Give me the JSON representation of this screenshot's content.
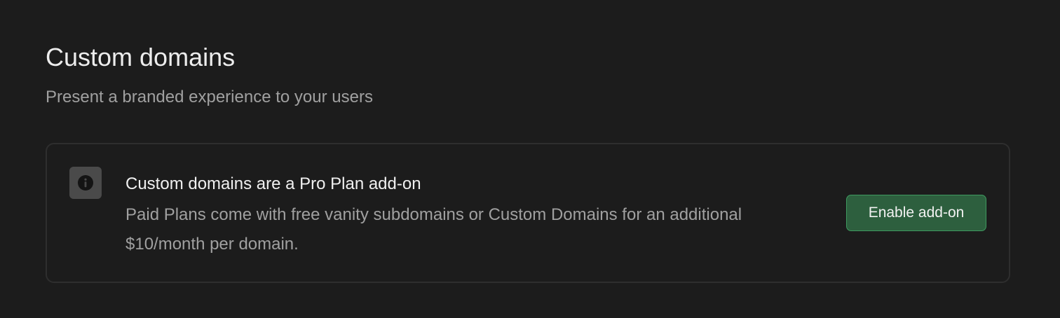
{
  "section": {
    "title": "Custom domains",
    "subtitle": "Present a branded experience to your users"
  },
  "notice": {
    "icon": "info-icon",
    "title": "Custom domains are a Pro Plan add-on",
    "description": "Paid Plans come with free vanity subdomains or Custom Domains for an additional $10/month per domain.",
    "button_label": "Enable add-on"
  },
  "colors": {
    "background": "#1c1c1c",
    "card_border": "#2e2e2e",
    "icon_badge": "#4a4a4a",
    "button_bg": "#2d5f3e",
    "button_border": "#3e9a5f"
  }
}
